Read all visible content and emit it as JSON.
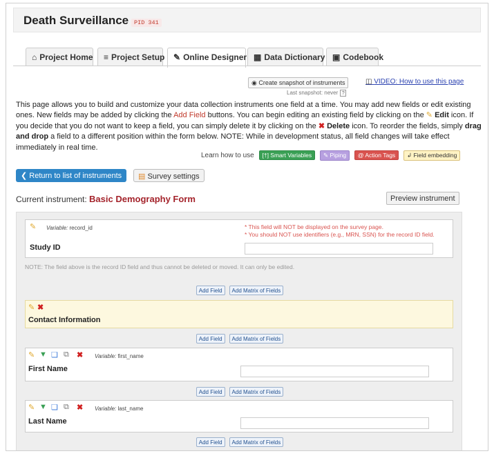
{
  "project": {
    "title": "Death Surveillance",
    "pid": "PID 341"
  },
  "tabs": [
    {
      "label": "Project Home",
      "icon": "home-icon"
    },
    {
      "label": "Project Setup",
      "icon": "list-icon"
    },
    {
      "label": "Online Designer",
      "icon": "edit-icon"
    },
    {
      "label": "Data Dictionary",
      "icon": "book-icon"
    },
    {
      "label": "Codebook",
      "icon": "codebook-icon"
    }
  ],
  "snapshot": {
    "button": "Create snapshot of instruments",
    "last": "Last snapshot: never",
    "help": "?"
  },
  "video": {
    "label": "VIDEO: How to use this page"
  },
  "intro": {
    "p1": "This page allows you to build and customize your data collection instruments one field at a time. You may add new fields or edit existing ones. New fields may be added by clicking the ",
    "add_field": "Add Field",
    "p2": " buttons. You can begin editing an existing field by clicking on the ",
    "edit": "Edit",
    "p3": " icon. If you decide that you do not want to keep a field, you can simply delete it by clicking on the ",
    "delete": "Delete",
    "p4": " icon. To reorder the fields, simply ",
    "drag": "drag and drop",
    "p5": " a field to a different position within the form below. NOTE: While in development status, all field changes will take effect immediately in real time."
  },
  "learn": {
    "label": "Learn how to use",
    "smart": "[†] Smart Variables",
    "piping": "Piping",
    "action": "@ Action Tags",
    "embed": "Field embedding"
  },
  "actions": {
    "return": "Return to list of instruments",
    "survey": "Survey settings",
    "preview": "Preview instrument"
  },
  "instrument": {
    "label": "Current instrument: ",
    "name": "Basic Demography Form"
  },
  "add_field": "Add Field",
  "add_matrix": "Add Matrix of Fields",
  "record_field": {
    "variable_label": "Variable:",
    "variable": "record_id",
    "label": "Study ID",
    "warn1": "* This field will NOT be displayed on the survey page.",
    "warn2": "* You should NOT use identifiers (e.g., MRN, SSN) for the record ID field.",
    "note": "NOTE: The field above is the record ID field and thus cannot be deleted or moved. It can only be edited."
  },
  "header_field": {
    "label": "Contact Information"
  },
  "fields": [
    {
      "variable_label": "Variable:",
      "variable": "first_name",
      "label": "First Name"
    },
    {
      "variable_label": "Variable:",
      "variable": "last_name",
      "label": "Last Name"
    }
  ]
}
